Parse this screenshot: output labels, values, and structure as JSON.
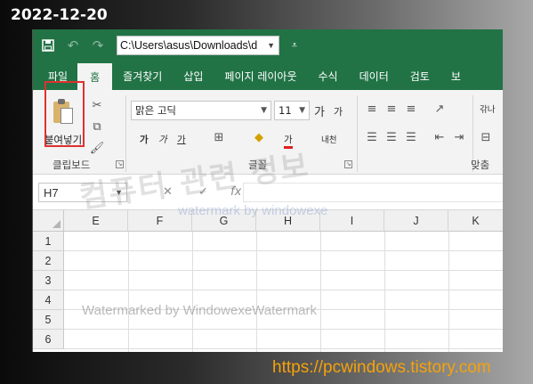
{
  "overlay": {
    "date": "2022-12-20",
    "site": "https://pcwindows.tistory.com",
    "watermark_korean": "컴퓨터 관련 정보",
    "watermark_mid": "watermark by windowexe",
    "watermark_bottom": "Watermarked by WindowexeWatermark"
  },
  "titlebar": {
    "path": "C:\\Users\\asus\\Downloads\\d",
    "icons": [
      "save-icon",
      "undo-icon",
      "redo-icon",
      "customize-icon"
    ]
  },
  "tabs": [
    {
      "label": "파일",
      "active": false
    },
    {
      "label": "홈",
      "active": true
    },
    {
      "label": "즐겨찾기",
      "active": false
    },
    {
      "label": "삽입",
      "active": false
    },
    {
      "label": "페이지 레이아웃",
      "active": false
    },
    {
      "label": "수식",
      "active": false
    },
    {
      "label": "데이터",
      "active": false
    },
    {
      "label": "검토",
      "active": false
    },
    {
      "label": "보",
      "active": false
    }
  ],
  "ribbon": {
    "clipboard": {
      "paste_label": "붙여넣기",
      "group_label": "클립보드"
    },
    "font": {
      "font_name": "맑은 고딕",
      "font_size": "11",
      "grow": "가",
      "shrink": "가",
      "bold": "가",
      "italic": "가",
      "underline": "가",
      "font_color": "가",
      "phonetic": "내천",
      "group_label": "글꼴"
    },
    "alignment": {
      "group_label": "맞춤",
      "wrap_label": "갂나"
    }
  },
  "formula_bar": {
    "name_box": "H7",
    "cancel": "✕",
    "enter": "✓",
    "fx": "fx",
    "value": ""
  },
  "sheet": {
    "columns": [
      "E",
      "F",
      "G",
      "H",
      "I",
      "J",
      "K"
    ],
    "rows": [
      "1",
      "2",
      "3",
      "4",
      "5",
      "6"
    ]
  },
  "colors": {
    "excel_green": "#217346",
    "highlight_red": "#e03030",
    "site_orange": "#f5a20a"
  }
}
